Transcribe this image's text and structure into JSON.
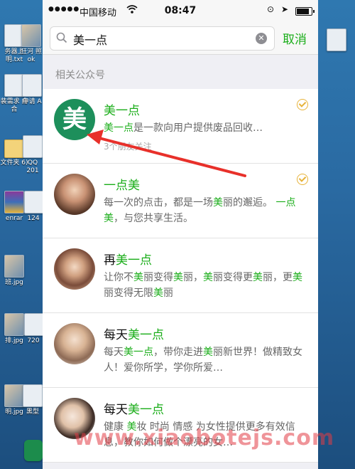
{
  "status_bar": {
    "carrier": "中国移动",
    "time": "08:47"
  },
  "search": {
    "query": "美一点",
    "cancel_label": "取消"
  },
  "section_title": "相关公众号",
  "results": [
    {
      "avatar_text": "美",
      "title_parts": [
        "",
        "美一点",
        ""
      ],
      "desc_parts": [
        "",
        "美一点",
        "是一款向用户提供废品回收…"
      ],
      "meta": "3个朋友关注",
      "verified": true
    },
    {
      "title_parts": [
        "",
        "一点美",
        ""
      ],
      "desc_parts": [
        "每一次的点击，都是一场",
        "美",
        "丽的邂逅。",
        "一点美",
        "，与您共享生活。"
      ],
      "verified": true
    },
    {
      "title_parts": [
        "再",
        "美一点",
        ""
      ],
      "desc_parts": [
        "让你不",
        "美",
        "丽变得",
        "美",
        "丽，",
        "美",
        "丽变得更",
        "美",
        "丽，更",
        "美",
        "丽变得无限",
        "美",
        "丽"
      ],
      "verified": false
    },
    {
      "title_parts": [
        "每天",
        "美一点",
        ""
      ],
      "desc_parts": [
        "每天",
        "美一点",
        "，带你走进",
        "美",
        "丽新世界！做精致女人！爱你所学，学你所爱…"
      ],
      "verified": false
    },
    {
      "title_parts": [
        "每天",
        "美一点",
        ""
      ],
      "desc_parts": [
        "健康 ",
        "美",
        "妆 时尚 情感 为女性提供更多有效信息，教你如何做个漂亮的女…"
      ],
      "verified": false
    }
  ],
  "desktop_files": [
    {
      "label": "务器上\n明.txt"
    },
    {
      "label": "狂河\n照ok"
    },
    {
      "label": "装需求\n白合"
    },
    {
      "label": "申请\nA"
    },
    {
      "label": "文件夹\n6)"
    },
    {
      "label": "QQ\n201"
    },
    {
      "label": "enrar"
    },
    {
      "label": "124"
    },
    {
      "label": "班.jpg"
    },
    {
      "label": "排.jpg"
    },
    {
      "label": "720"
    },
    {
      "label": "明.jpg"
    },
    {
      "label": "黑型"
    }
  ],
  "watermark": "www.xiaobotejs.com",
  "colors": {
    "accent_green": "#1aad19",
    "logo_green": "#1d8f5b",
    "verified_gold": "#e7b33a",
    "arrow_red": "#e8302a",
    "watermark_red": "#e13c46"
  }
}
